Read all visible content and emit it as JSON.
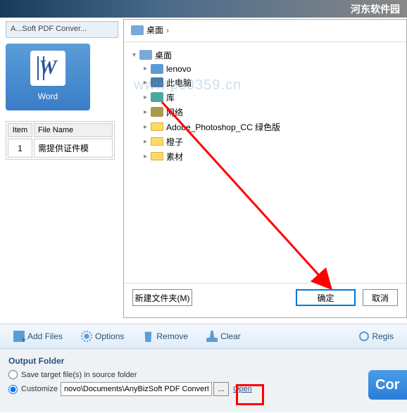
{
  "banner": {
    "text": "河东软件园"
  },
  "titlebar": {
    "text": "A...Soft PDF Conver..."
  },
  "word_tile": {
    "label": "Word"
  },
  "file_table": {
    "headers": {
      "item": "Item",
      "filename": "File Name"
    },
    "rows": [
      {
        "item": "1",
        "filename": "需提供证件模"
      }
    ]
  },
  "dialog": {
    "path_label": "桌面",
    "tree": {
      "root": "桌面",
      "items": [
        {
          "icon": "icon-folder-blue",
          "label": "lenovo"
        },
        {
          "icon": "icon-pc",
          "label": "此电脑"
        },
        {
          "icon": "icon-lib",
          "label": "库"
        },
        {
          "icon": "icon-net",
          "label": "网络"
        },
        {
          "icon": "icon-folder-y",
          "label": "Adobe_Photoshop_CC 绿色版"
        },
        {
          "icon": "icon-folder-y",
          "label": "橙子"
        },
        {
          "icon": "icon-folder-y",
          "label": "素材"
        }
      ]
    },
    "buttons": {
      "new_folder": "新建文件夹(M)",
      "ok": "确定",
      "cancel": "取消"
    }
  },
  "toolbar": {
    "add": "Add Files",
    "options": "Options",
    "remove": "Remove",
    "clear": "Clear",
    "regis": "Regis"
  },
  "output": {
    "title": "Output Folder",
    "opt_source": "Save target file(s) in source folder",
    "opt_custom": "Customize",
    "path_value": "novo\\Documents\\AnyBizSoft PDF Converter\\",
    "browse": "...",
    "open": "Open",
    "convert": "Cor"
  },
  "watermark": "www.pc0359.cn"
}
